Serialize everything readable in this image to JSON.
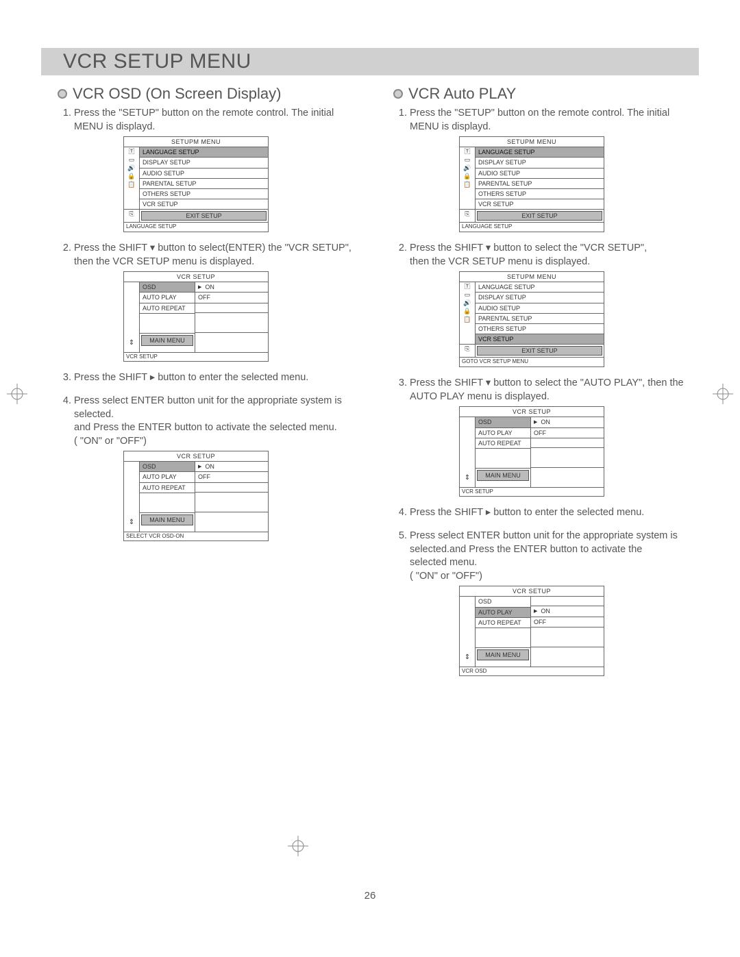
{
  "page_number": "26",
  "title": "VCR SETUP MENU",
  "left": {
    "heading": "VCR OSD (On Screen Display)",
    "steps": {
      "s1": "Press the \"SETUP\" button on the remote control. The initial MENU is displayd.",
      "s2a": "Press the SHIFT ▾  button to select(ENTER) the \"VCR SETUP\",",
      "s2b": "then the VCR SETUP menu is displayed.",
      "s3": "Press the SHIFT ▸  button to enter the selected menu.",
      "s4a": "Press select ENTER button unit for the appropriate system is selected.",
      "s4b": "and Press the ENTER button to activate the selected menu.",
      "s4c": "( \"ON\" or \"OFF\")"
    }
  },
  "right": {
    "heading": "VCR Auto PLAY",
    "steps": {
      "s1": "Press the \"SETUP\" button on the remote control. The initial MENU is displayd.",
      "s2a": "Press the SHIFT ▾  button to select the \"VCR SETUP\",",
      "s2b": "then the VCR SETUP menu is displayed.",
      "s3": "Press the SHIFT ▾  button to select the \"AUTO PLAY\", then the AUTO PLAY menu is displayed.",
      "s4": "Press the SHIFT ▸  button to enter the selected menu.",
      "s5a": "Press select ENTER button unit for the appropriate system is selected.and Press the ENTER button to activate the",
      "s5b": "selected menu.",
      "s5c": "( \"ON\" or \"OFF\")"
    }
  },
  "osd_main": {
    "title": "SETUPM MENU",
    "items": {
      "i0": "LANGUAGE SETUP",
      "i1": "DISPLAY SETUP",
      "i2": "AUDIO SETUP",
      "i3": "PARENTAL SETUP",
      "i4": "OTHERS SETUP",
      "i5": "VCR SETUP"
    },
    "exit": "EXIT SETUP",
    "status_lang": "LANGUAGE SETUP",
    "status_goto": "GOTO VCR  SETUP MENU"
  },
  "osd_vcr": {
    "title": "VCR SETUP",
    "keys": {
      "k0": "OSD",
      "k1": "AUTO PLAY",
      "k2": "AUTO REPEAT"
    },
    "vals": {
      "on": "ON",
      "off": "OFF"
    },
    "main_menu": "MAIN MENU",
    "status_plain": "VCR SETUP",
    "status_select": "SELECT VCR OSD-ON",
    "status_osd": "VCR OSD"
  },
  "icons": {
    "i0": "🅃",
    "i1": "▭",
    "i2": "🔊",
    "i3": "🔒",
    "i4": "📋",
    "arrow": "⇕",
    "exit": "⎘"
  }
}
